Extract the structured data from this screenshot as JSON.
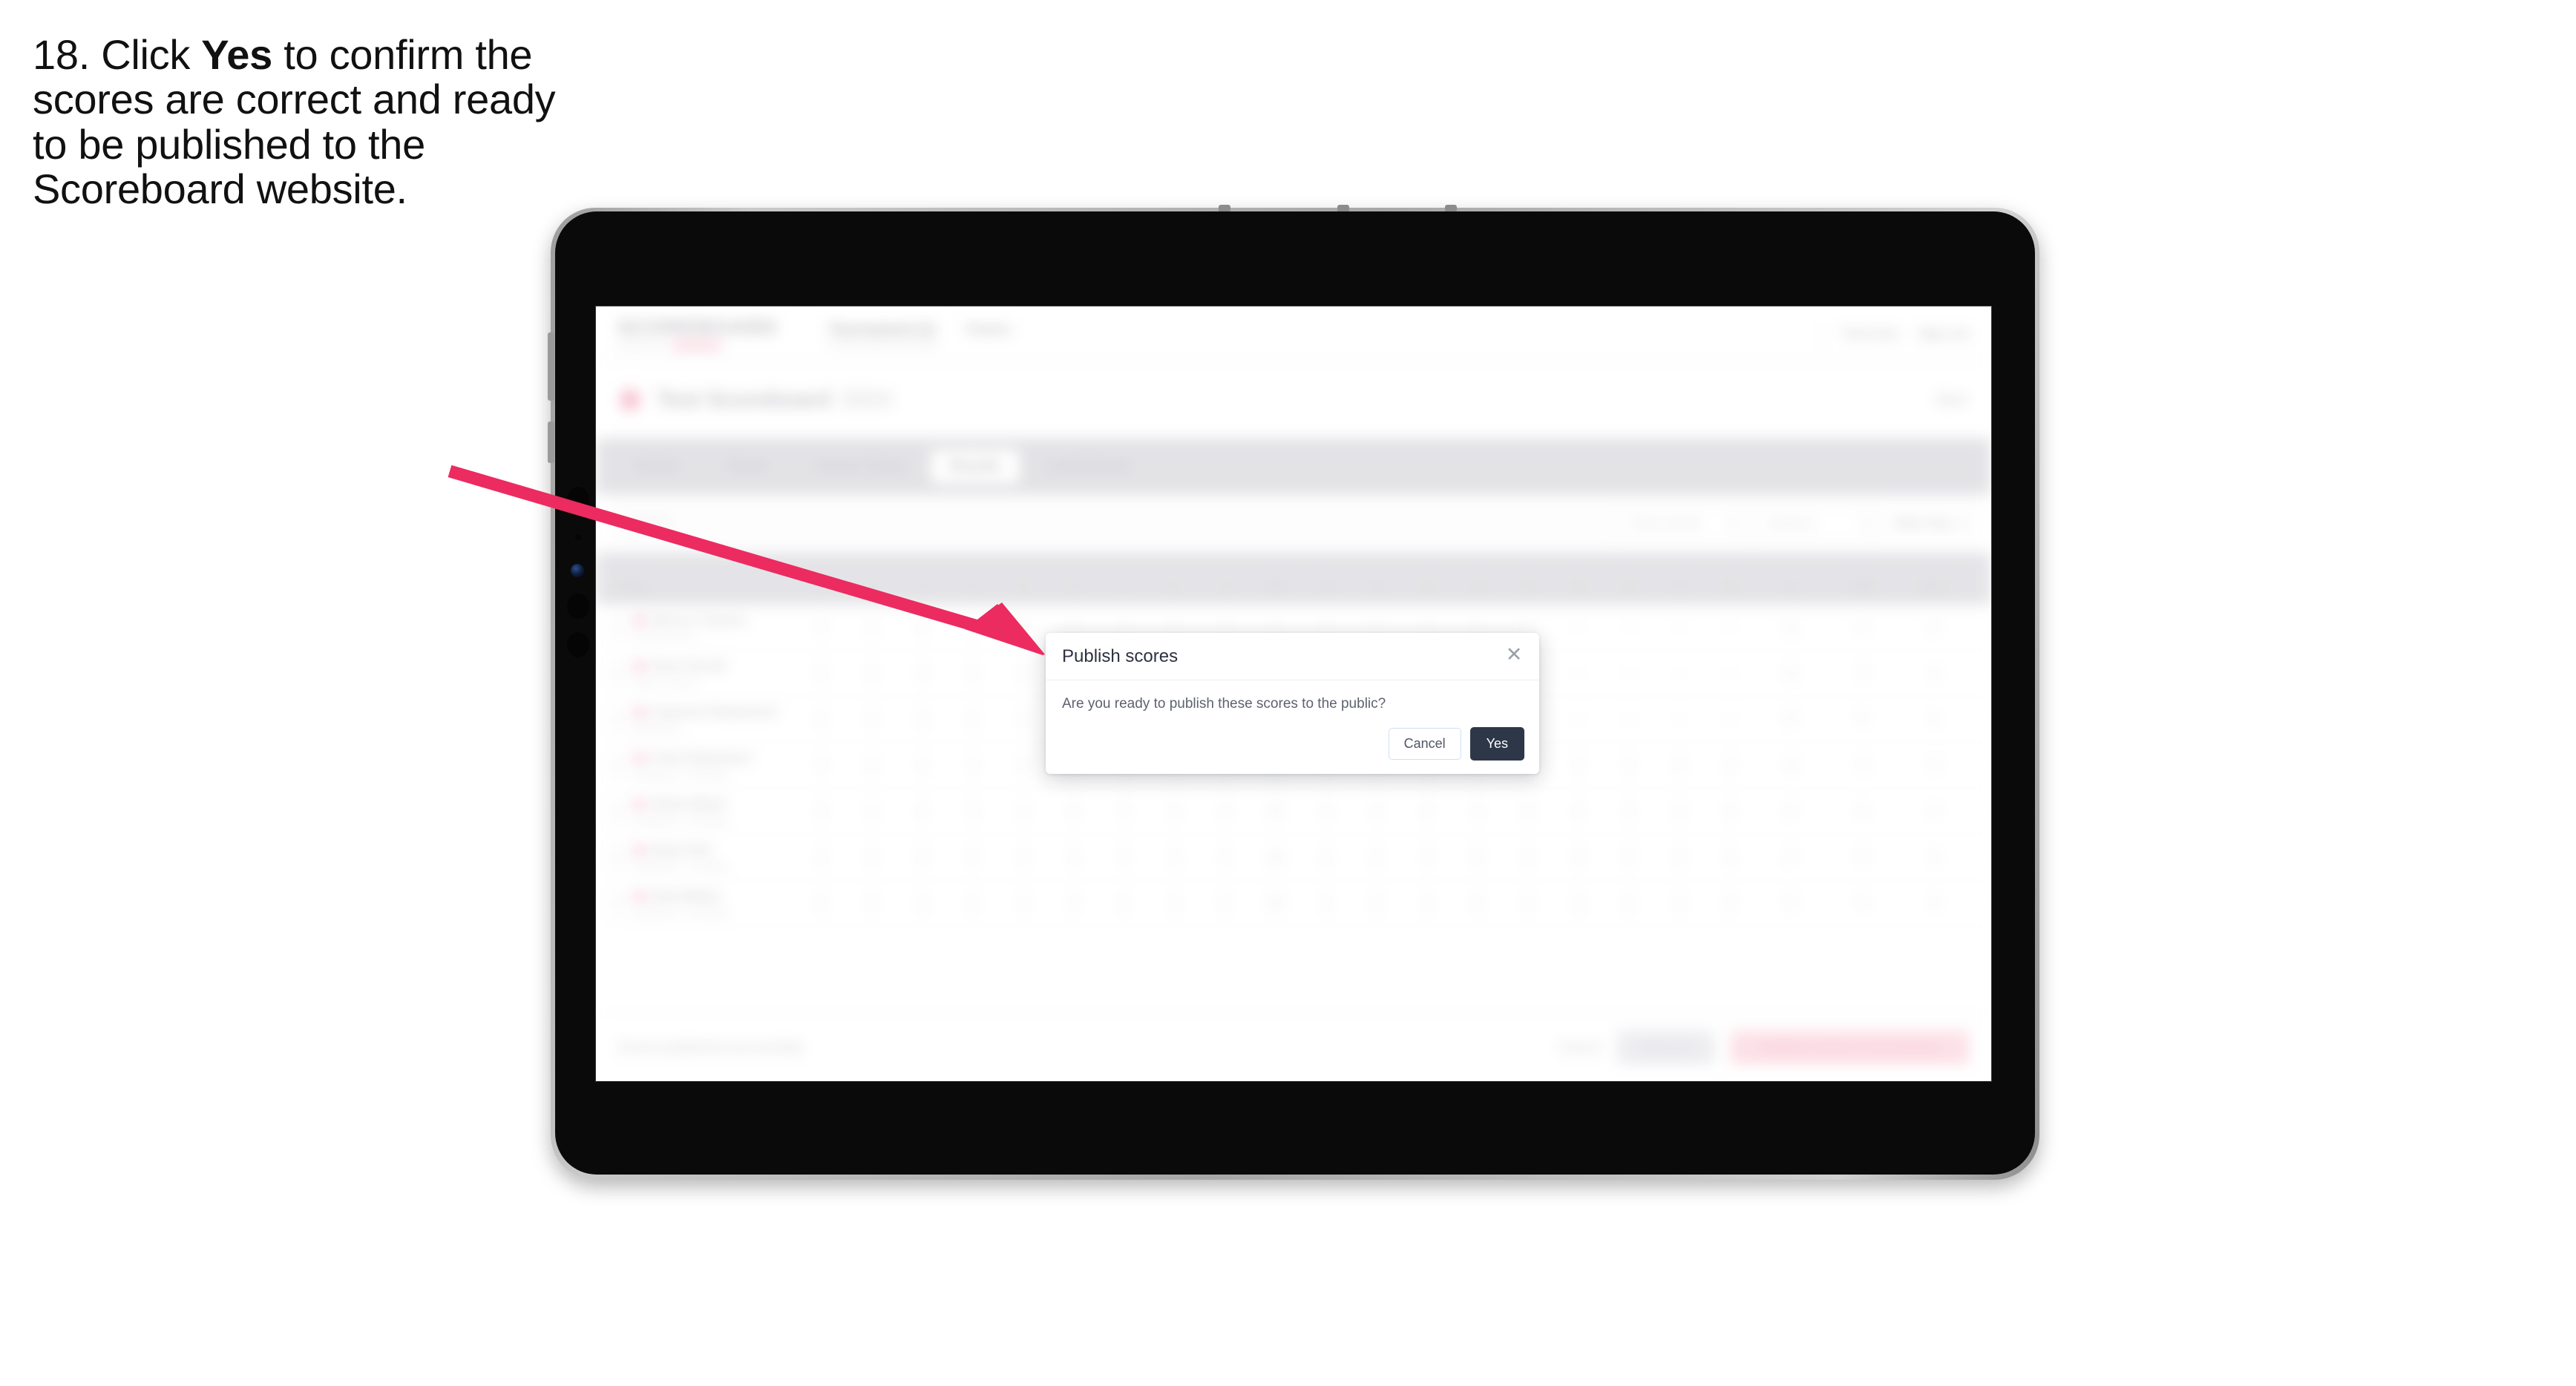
{
  "caption": {
    "prefix": "18. Click ",
    "emphasis": "Yes",
    "suffix": " to confirm the scores are correct and ready to be published to the Scoreboard website."
  },
  "colors": {
    "arrow": "#ec2b60",
    "primary_button": "#2d3748",
    "brand_pink": "#f07e9c"
  },
  "annotation": {
    "arrow_name": "pointer-arrow"
  },
  "app": {
    "brand": "SCOREBOARD",
    "brand_sub": "Powered by",
    "brand_pill": "ENGAGE",
    "top_nav": [
      {
        "label": "Tournament (1)"
      },
      {
        "label": "Teams"
      }
    ],
    "top_right": [
      {
        "label": "Test User"
      },
      {
        "label": "Sign out"
      }
    ],
    "subhead": {
      "title": "Test Scoreboard",
      "faint": "2024",
      "right": "Back"
    },
    "tabs": [
      {
        "label": "Details",
        "active": false
      },
      {
        "label": "Teams",
        "active": false
      },
      {
        "label": "Course Setup",
        "active": false
      },
      {
        "label": "Results",
        "active": true
      },
      {
        "label": "Leaderboard",
        "active": false
      }
    ],
    "toolbar": {
      "search_placeholder": "Search",
      "select_round": "Pick a round",
      "select_team": "Round 1",
      "link_label": "Table Only"
    },
    "table": {
      "headers": [
        "Player",
        "1",
        "2",
        "3",
        "4",
        "5",
        "6",
        "7",
        "8",
        "9",
        "Out",
        "10",
        "11",
        "12",
        "13",
        "14",
        "15",
        "16",
        "17",
        "18",
        "In",
        "Total",
        "Score"
      ],
      "rows": [
        {
          "name": "Marcus Tavares",
          "team": "Team A Group",
          "scores": [
            "4",
            "3",
            "5",
            "4",
            "4",
            "",
            "",
            "",
            "",
            "",
            "",
            "",
            "",
            "",
            "",
            "",
            "",
            "",
            "",
            "36",
            "72",
            "+2",
            "E"
          ]
        },
        {
          "name": "Ross Farrell",
          "team": "Team C Group",
          "scores": [
            "5",
            "4",
            "4",
            "3",
            "4",
            "",
            "",
            "",
            "",
            "",
            "",
            "",
            "",
            "",
            "",
            "",
            "",
            "",
            "",
            "38",
            "74",
            "+4",
            "E"
          ]
        },
        {
          "name": "Cameron Rutherford",
          "team": "Rutherford",
          "scores": [
            "4",
            "4",
            "4",
            "5",
            "4",
            "",
            "",
            "",
            "",
            "",
            "",
            "",
            "",
            "",
            "",
            "",
            "",
            "",
            "",
            "36",
            "71",
            "+1",
            "E"
          ]
        },
        {
          "name": "Chris Robertson",
          "team": "Scotland A - Thursday",
          "scores": [
            "4",
            "5",
            "4",
            "4",
            "3",
            "4",
            "4",
            "5",
            "4",
            "37",
            "4",
            "4",
            "5",
            "4",
            "4",
            "3",
            "4",
            "4",
            "4",
            "36",
            "73",
            "+3",
            "E"
          ]
        },
        {
          "name": "Oliver Black",
          "team": "Scotland A - Thursday",
          "scores": [
            "3",
            "4",
            "4",
            "5",
            "4",
            "4",
            "4",
            "4",
            "5",
            "37",
            "4",
            "4",
            "4",
            "4",
            "5",
            "4",
            "4",
            "4",
            "4",
            "37",
            "74",
            "+4",
            "E"
          ]
        },
        {
          "name": "Ryan Kirk",
          "team": "Scotland A - Thursday",
          "scores": [
            "4",
            "4",
            "5",
            "4",
            "4",
            "4",
            "5",
            "4",
            "4",
            "38",
            "4",
            "4",
            "4",
            "5",
            "4",
            "4",
            "4",
            "4",
            "4",
            "37",
            "75",
            "+5",
            "E"
          ]
        },
        {
          "name": "Nick Bailey",
          "team": "Scotland A - Thursday",
          "scores": [
            "4",
            "5",
            "4",
            "4",
            "4",
            "4",
            "4",
            "4",
            "5",
            "38",
            "4",
            "5",
            "4",
            "4",
            "4",
            "4",
            "4",
            "4",
            "4",
            "37",
            "75",
            "+5",
            "E"
          ]
        }
      ]
    },
    "footer": {
      "note": "Scores published successfully",
      "cancel": "Cancel",
      "save": "Save all",
      "publish": "Publish scores to Scoreboard"
    }
  },
  "modal": {
    "title": "Publish scores",
    "message": "Are you ready to publish these scores to the public?",
    "close_icon": "close-icon",
    "cancel_label": "Cancel",
    "confirm_label": "Yes"
  }
}
